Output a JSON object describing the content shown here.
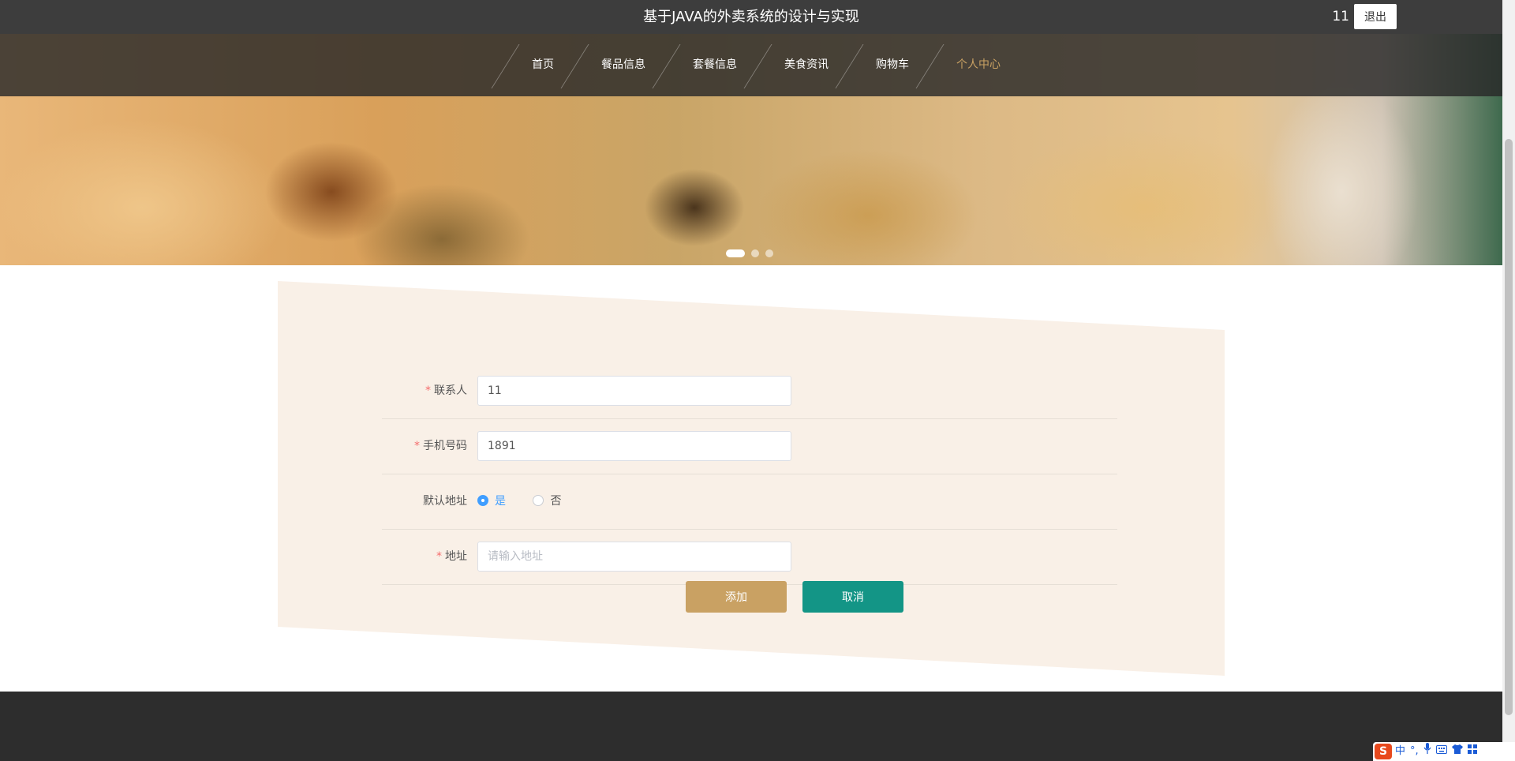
{
  "header": {
    "title": "基于JAVA的外卖系统的设计与实现",
    "username": "11",
    "logout_label": "退出"
  },
  "nav": {
    "items": [
      {
        "label": "首页"
      },
      {
        "label": "餐品信息"
      },
      {
        "label": "套餐信息"
      },
      {
        "label": "美食资讯"
      },
      {
        "label": "购物车"
      },
      {
        "label": "个人中心",
        "active": true
      }
    ]
  },
  "banner": {
    "slide_count": 3,
    "active_slide": 1
  },
  "form": {
    "contact": {
      "label": "联系人",
      "required": "*",
      "value": "11"
    },
    "phone": {
      "label": "手机号码",
      "required": "*",
      "value": "1891"
    },
    "default_address": {
      "label": "默认地址",
      "options": [
        "是",
        "否"
      ],
      "selected": "是"
    },
    "address": {
      "label": "地址",
      "required": "*",
      "value": "",
      "placeholder": "请输入地址"
    },
    "add_label": "添加",
    "cancel_label": "取消"
  },
  "ime": {
    "logo": "S",
    "mode": "中",
    "punct": "°,",
    "icons": [
      "microphone-icon",
      "keyboard-icon",
      "shirt-icon",
      "grid-icon"
    ]
  },
  "colors": {
    "accent_gold": "#c9a163",
    "accent_teal": "#139586",
    "radio_blue": "#409eff",
    "required_red": "#f56c6c",
    "topbar": "#3d3d3d",
    "form_bg": "#f9f0e7",
    "footer": "#2d2d2d"
  }
}
